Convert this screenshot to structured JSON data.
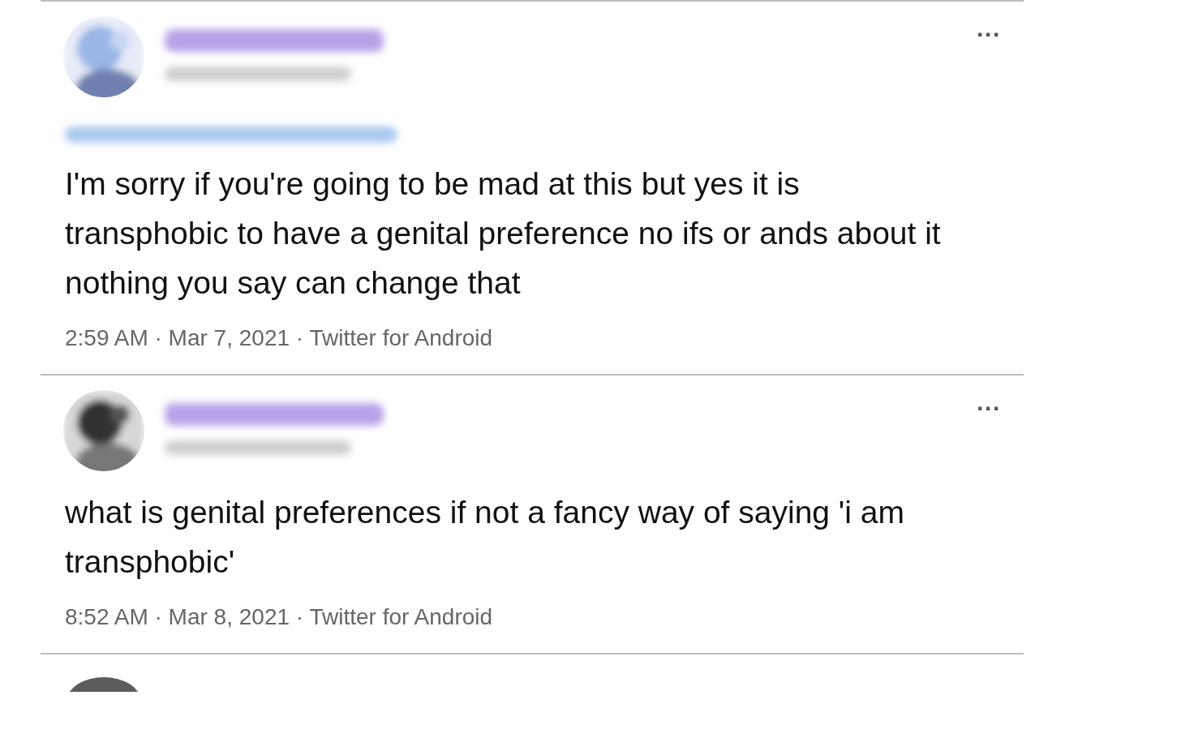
{
  "tweets": [
    {
      "replying_line": true,
      "more": "···",
      "text": "I'm sorry if you're going to be mad at this but yes it is transphobic to have a genital preference no ifs or ands about it nothing you say can change that",
      "meta": "2:59 AM · Mar 7, 2021 · Twitter for Android"
    },
    {
      "replying_line": false,
      "more": "···",
      "text": "what is genital preferences if not a fancy way of saying 'i am transphobic'",
      "meta": "8:52 AM · Mar 8, 2021 · Twitter for Android"
    }
  ]
}
